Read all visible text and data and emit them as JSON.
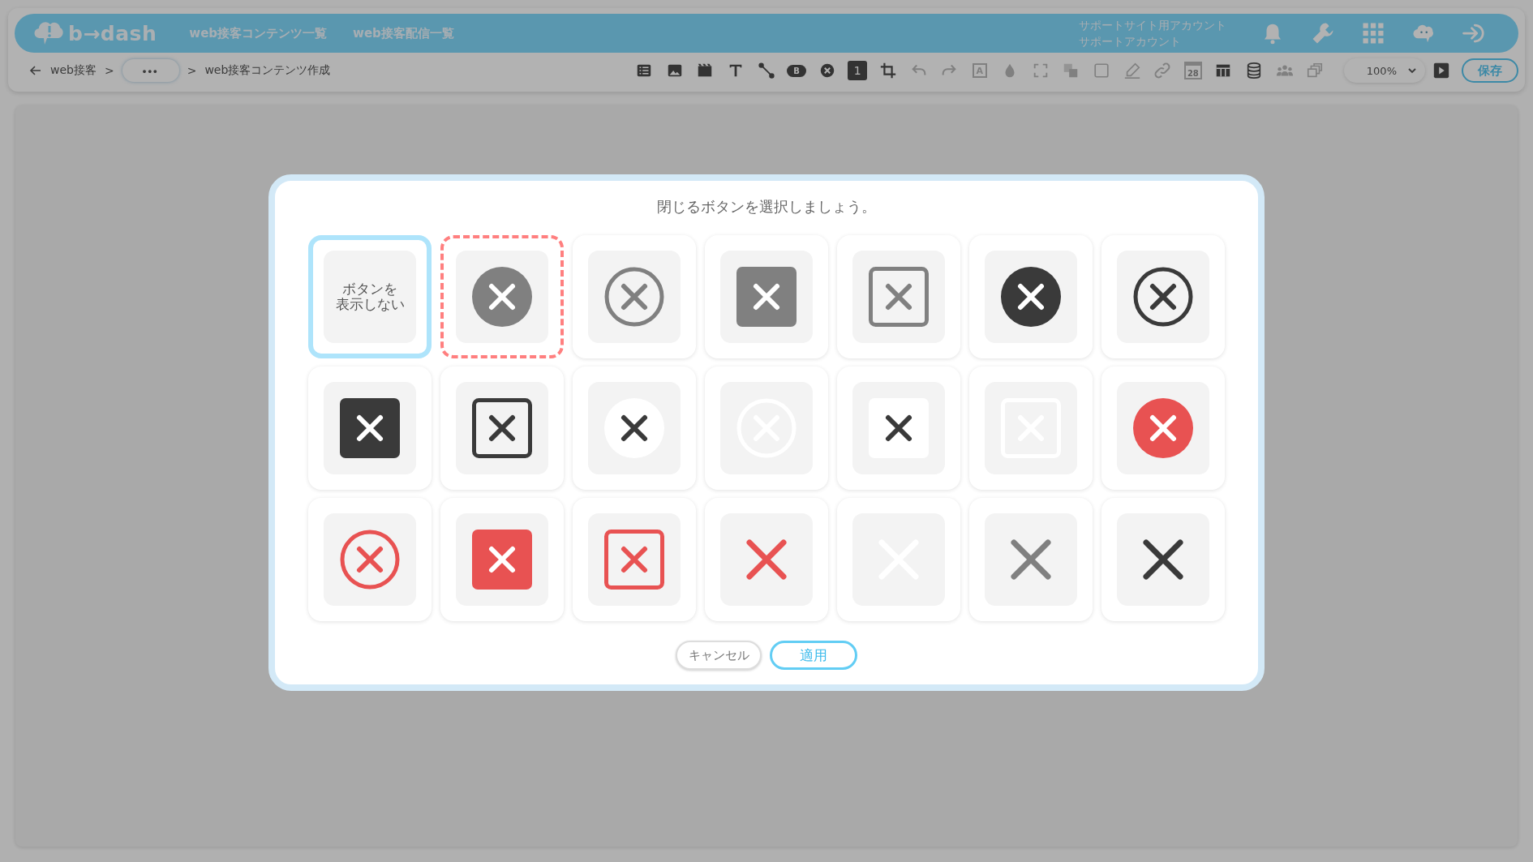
{
  "header": {
    "logo": "b→dash",
    "nav": [
      {
        "label": "web接客コンテンツ一覧"
      },
      {
        "label": "web接客配信一覧"
      }
    ],
    "account": {
      "site": "サポートサイト用アカウント",
      "user": "サポートアカウント"
    },
    "icons": [
      {
        "kind": "bell"
      },
      {
        "kind": "wrench"
      },
      {
        "kind": "grid"
      },
      {
        "kind": "mascot"
      },
      {
        "kind": "logout"
      }
    ]
  },
  "breadcrumb": [
    {
      "label": "web接客",
      "kind": "link",
      "separator": ">"
    },
    {
      "label": "•••",
      "kind": "more",
      "separator": ">"
    },
    {
      "label": "web接客コンテンツ作成",
      "kind": "current"
    }
  ],
  "toolbar": {
    "tools": [
      {
        "kind": "list",
        "disabled": false
      },
      {
        "kind": "image",
        "disabled": false
      },
      {
        "kind": "video",
        "disabled": false
      },
      {
        "kind": "text",
        "disabled": false
      },
      {
        "kind": "connector",
        "disabled": false
      },
      {
        "kind": "pill",
        "label": "B",
        "disabled": false
      },
      {
        "kind": "close",
        "disabled": false
      },
      {
        "kind": "number",
        "label": "1",
        "disabled": false
      },
      {
        "kind": "crop",
        "disabled": false
      },
      {
        "kind": "undo",
        "disabled": true
      },
      {
        "kind": "redo",
        "disabled": true
      },
      {
        "kind": "frame",
        "label": "A",
        "disabled": true
      },
      {
        "kind": "drop",
        "disabled": true
      },
      {
        "kind": "expand",
        "disabled": true
      },
      {
        "kind": "layers",
        "disabled": true
      },
      {
        "kind": "square",
        "disabled": true
      },
      {
        "kind": "pen",
        "disabled": true
      },
      {
        "kind": "link",
        "disabled": true
      },
      {
        "kind": "calendar",
        "label": "28",
        "disabled": true
      },
      {
        "kind": "table",
        "disabled": false
      },
      {
        "kind": "database",
        "disabled": false
      },
      {
        "kind": "people",
        "disabled": true
      },
      {
        "kind": "windows",
        "disabled": true
      }
    ],
    "zoom": "100%",
    "save": "保存"
  },
  "dialog": {
    "title": "閉じるボタンを選択しましょう。",
    "options": [
      {
        "kind": "text",
        "label_lines": [
          "ボタンを",
          "表示しない"
        ],
        "selected": true,
        "hovered": false
      },
      {
        "kind": "circle-filled",
        "color": "#808080",
        "selected": false,
        "hovered": true
      },
      {
        "kind": "circle-outline",
        "color": "#808080",
        "selected": false,
        "hovered": false
      },
      {
        "kind": "square-filled",
        "color": "#808080",
        "selected": false,
        "hovered": false
      },
      {
        "kind": "square-outline",
        "color": "#808080",
        "selected": false,
        "hovered": false
      },
      {
        "kind": "circle-filled",
        "color": "#3a3a3a",
        "selected": false,
        "hovered": false
      },
      {
        "kind": "circle-outline",
        "color": "#3a3a3a",
        "selected": false,
        "hovered": false
      },
      {
        "kind": "square-filled",
        "color": "#3a3a3a",
        "selected": false,
        "hovered": false
      },
      {
        "kind": "square-outline",
        "color": "#3a3a3a",
        "selected": false,
        "hovered": false
      },
      {
        "kind": "circle-white",
        "color": "#3a3a3a",
        "selected": false,
        "hovered": false
      },
      {
        "kind": "circle-outline",
        "color": "#ffffff",
        "selected": false,
        "hovered": false
      },
      {
        "kind": "square-white",
        "color": "#3a3a3a",
        "selected": false,
        "hovered": false
      },
      {
        "kind": "square-outline",
        "color": "#ffffff",
        "selected": false,
        "hovered": false
      },
      {
        "kind": "circle-filled",
        "color": "#e85252",
        "selected": false,
        "hovered": false
      },
      {
        "kind": "circle-outline",
        "color": "#e85252",
        "selected": false,
        "hovered": false
      },
      {
        "kind": "square-filled",
        "color": "#e85252",
        "selected": false,
        "hovered": false
      },
      {
        "kind": "square-outline",
        "color": "#e85252",
        "selected": false,
        "hovered": false
      },
      {
        "kind": "plain-x",
        "color": "#e85252",
        "selected": false,
        "hovered": false
      },
      {
        "kind": "plain-x",
        "color": "#ffffff",
        "selected": false,
        "hovered": false
      },
      {
        "kind": "plain-x",
        "color": "#808080",
        "selected": false,
        "hovered": false
      },
      {
        "kind": "plain-x",
        "color": "#3a3a3a",
        "selected": false,
        "hovered": false
      }
    ],
    "buttons": [
      {
        "kind": "cancel",
        "label": "キャンセル"
      },
      {
        "kind": "apply",
        "label": "適用"
      }
    ]
  }
}
